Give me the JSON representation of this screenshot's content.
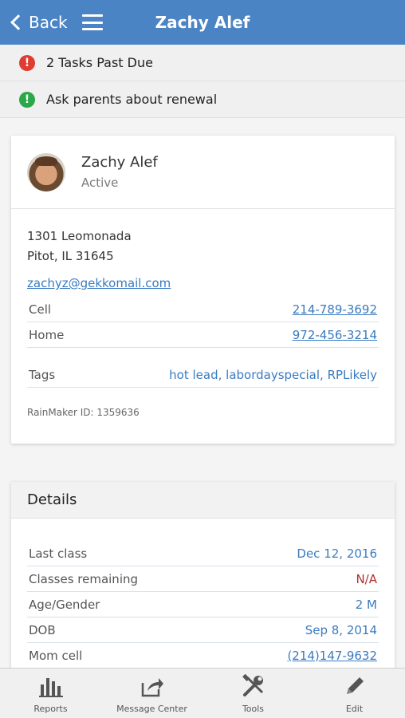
{
  "header": {
    "back_label": "Back",
    "title": "Zachy Alef"
  },
  "alerts": [
    {
      "text": "2 Tasks Past Due",
      "status": "error"
    },
    {
      "text": "Ask parents about renewal",
      "status": "ok"
    }
  ],
  "contact": {
    "name": "Zachy Alef",
    "status": "Active",
    "address_line1": "1301 Leomonada",
    "address_line2": "Pitot, IL 31645",
    "email": "zachyz@gekkomail.com",
    "phones": [
      {
        "label": "Cell",
        "value": "214-789-3692"
      },
      {
        "label": "Home",
        "value": "972-456-3214"
      }
    ],
    "tags_label": "Tags",
    "tags": "hot lead, labordayspecial, RPLikely",
    "rainmaker_id": "RainMaker ID: 1359636"
  },
  "details": {
    "title": "Details",
    "rows": [
      {
        "label": "Last class",
        "value": "Dec 12, 2016"
      },
      {
        "label": "Classes remaining",
        "value": "N/A"
      },
      {
        "label": "Age/Gender",
        "value": "2 M"
      },
      {
        "label": "DOB",
        "value": "Sep 8, 2014"
      },
      {
        "label": "Mom cell",
        "value": "(214)147-9632"
      }
    ]
  },
  "bottom_nav": [
    {
      "label": "Reports",
      "icon": "bar-chart-icon"
    },
    {
      "label": "Message Center",
      "icon": "share-icon"
    },
    {
      "label": "Tools",
      "icon": "tools-icon"
    },
    {
      "label": "Edit",
      "icon": "pencil-icon"
    }
  ],
  "colors": {
    "header": "#4a84c5",
    "link": "#3a7bbf",
    "error": "#e03c31",
    "ok": "#2aa84a",
    "na": "#b03030"
  }
}
